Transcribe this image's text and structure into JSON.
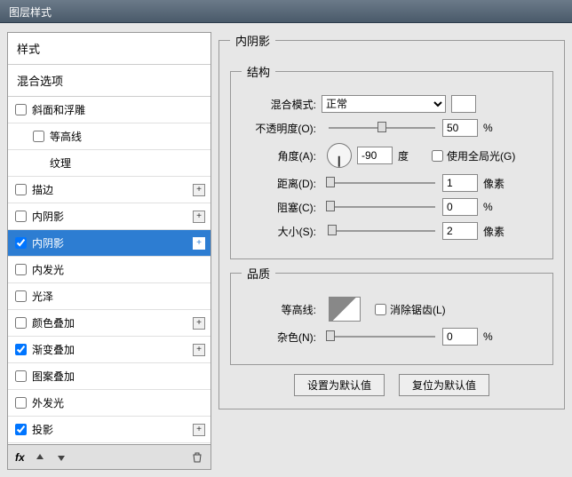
{
  "window": {
    "title": "图层样式"
  },
  "styles": {
    "header": "样式",
    "blending_options": "混合选项",
    "items": [
      {
        "label": "斜面和浮雕",
        "checked": false,
        "expandable": false
      },
      {
        "label": "等高线",
        "checked": false,
        "indent": true
      },
      {
        "label": "纹理",
        "checked": false,
        "indent": true,
        "nocb": true
      },
      {
        "label": "描边",
        "checked": false,
        "expandable": true
      },
      {
        "label": "内阴影",
        "checked": false,
        "expandable": true
      },
      {
        "label": "内阴影",
        "checked": true,
        "expandable": true,
        "selected": true
      },
      {
        "label": "内发光",
        "checked": false
      },
      {
        "label": "光泽",
        "checked": false
      },
      {
        "label": "颜色叠加",
        "checked": false,
        "expandable": true
      },
      {
        "label": "渐变叠加",
        "checked": true,
        "expandable": true
      },
      {
        "label": "图案叠加",
        "checked": false
      },
      {
        "label": "外发光",
        "checked": false
      },
      {
        "label": "投影",
        "checked": true,
        "expandable": true
      }
    ],
    "footer_fx": "fx"
  },
  "panel": {
    "title": "内阴影",
    "structure": {
      "legend": "结构",
      "blend_mode_label": "混合模式:",
      "blend_mode_value": "正常",
      "opacity_label": "不透明度(O):",
      "opacity_value": "50",
      "opacity_unit": "%",
      "angle_label": "角度(A):",
      "angle_value": "-90",
      "angle_unit": "度",
      "global_light_label": "使用全局光(G)",
      "global_light_checked": false,
      "distance_label": "距离(D):",
      "distance_value": "1",
      "distance_unit": "像素",
      "choke_label": "阻塞(C):",
      "choke_value": "0",
      "choke_unit": "%",
      "size_label": "大小(S):",
      "size_value": "2",
      "size_unit": "像素"
    },
    "quality": {
      "legend": "品质",
      "contour_label": "等高线:",
      "antialias_label": "消除锯齿(L)",
      "antialias_checked": false,
      "noise_label": "杂色(N):",
      "noise_value": "0",
      "noise_unit": "%"
    },
    "buttons": {
      "make_default": "设置为默认值",
      "reset_default": "复位为默认值"
    }
  },
  "slider_positions": {
    "opacity": 50,
    "distance": 2,
    "choke": 2,
    "size": 3,
    "noise": 2
  }
}
